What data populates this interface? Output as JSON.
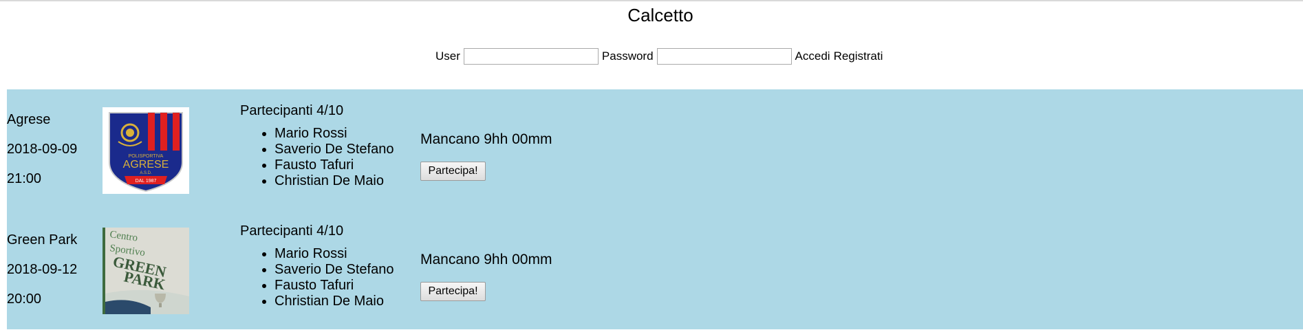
{
  "header": {
    "title": "Calcetto"
  },
  "login": {
    "user_label": "User",
    "password_label": "Password",
    "login_link": "Accedi",
    "register_link": "Registrati"
  },
  "events": [
    {
      "name": "Agrese",
      "date": "2018-09-09",
      "time": "21:00",
      "logo_text": {
        "top": "POLISPORTIVA",
        "main": "AGRESE",
        "sub": "A.S.D.",
        "ribbon": "DAL 1987"
      },
      "participants_label": "Partecipanti 4/10",
      "participants": [
        "Mario Rossi",
        "Saverio De Stefano",
        "Fausto Tafuri",
        "Christian De Maio"
      ],
      "countdown": "Mancano 9hh 00mm",
      "join_label": "Partecipa!"
    },
    {
      "name": "Green Park",
      "date": "2018-09-12",
      "time": "20:00",
      "logo_text": {
        "line1": "Centro",
        "line2": "Sportivo",
        "line3": "GREEN",
        "line4": "PARK"
      },
      "participants_label": "Partecipanti 4/10",
      "participants": [
        "Mario Rossi",
        "Saverio De Stefano",
        "Fausto Tafuri",
        "Christian De Maio"
      ],
      "countdown": "Mancano 9hh 00mm",
      "join_label": "Partecipa!"
    }
  ]
}
